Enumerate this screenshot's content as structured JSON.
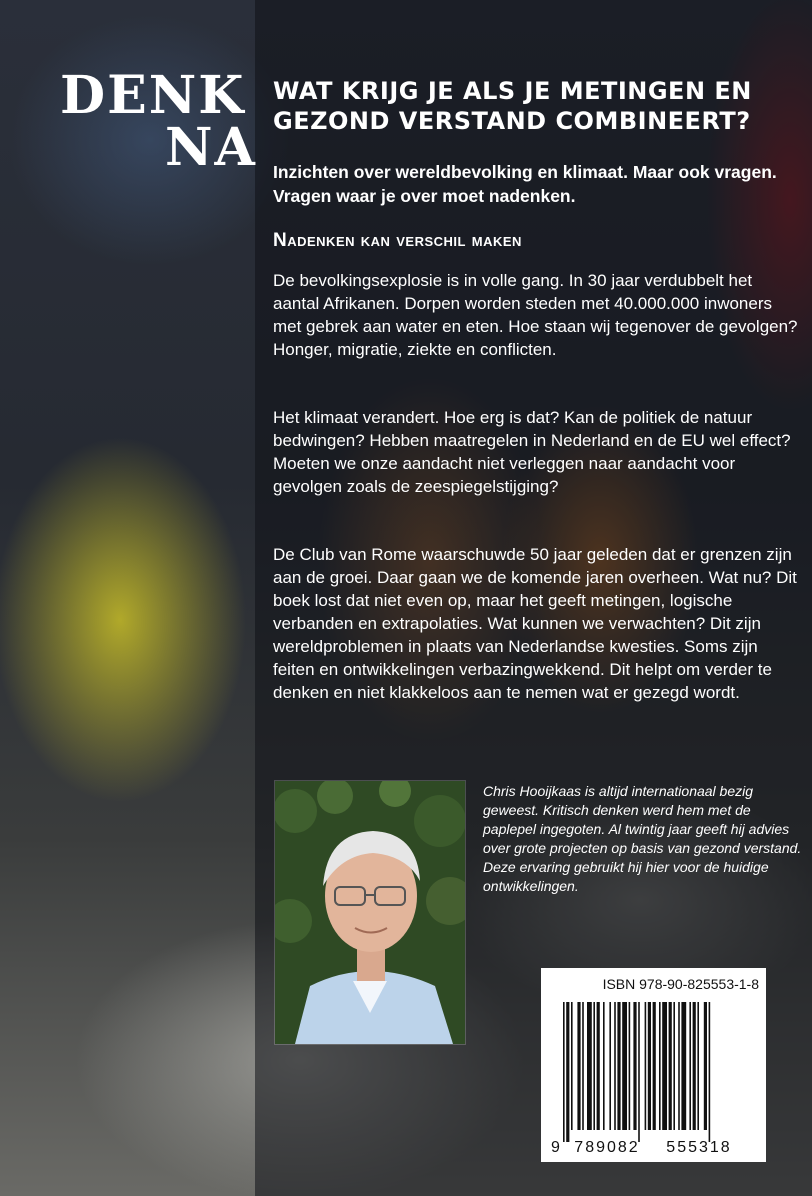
{
  "logo": {
    "line1": "DENK",
    "line2": "NA"
  },
  "headline": "WAT KRIJG JE ALS JE METINGEN EN GEZOND VERSTAND COMBINEERT?",
  "subtitle": "Inzichten over wereldbevolking en klimaat. Maar ook vragen. Vragen waar je over moet nadenken.",
  "section_title": "Nadenken kan verschil maken",
  "paragraphs": [
    "De bevolkingsexplosie is in volle gang. In 30 jaar verdubbelt het aantal Afrikanen. Dorpen worden steden met 40.000.000 inwoners met gebrek aan water en eten. Hoe staan wij tegenover de gevolgen? Honger, migratie, ziekte en conflicten.",
    "Het klimaat verandert. Hoe erg is dat? Kan de politiek de natuur bedwingen? Hebben maatregelen in Nederland en de EU wel effect? Moeten we onze aandacht niet verleggen naar aandacht voor gevolgen zoals de zeespiegelstijging?",
    "De Club van Rome waarschuwde 50 jaar geleden dat er grenzen zijn aan de groei. Daar gaan we de komende jaren overheen. Wat nu? Dit boek lost dat niet even op, maar het geeft metingen, logische verbanden en extrapolaties. Wat kunnen we verwachten? Dit zijn wereldproblemen in plaats van Nederlandse kwesties. Soms zijn feiten en ontwikkelingen verbazingwekkend. Dit helpt om verder te denken en niet klakkeloos aan te nemen wat er gezegd wordt."
  ],
  "author_bio": "Chris Hooijkaas is altijd internationaal bezig geweest. Kritisch denken werd hem met de paplepel ingegoten. Al twintig jaar geeft hij advies over grote projecten op basis van gezond verstand. Deze ervaring gebruikt hij hier voor de huidige ontwikkelingen.",
  "isbn_label": "ISBN 978-90-825553-1-8",
  "barcode_digits": {
    "first": "9",
    "left": "789082",
    "right": "555318"
  },
  "colors": {
    "text": "#ffffff",
    "shirt": "#bcd3ea",
    "hedge": "#2f4a24"
  }
}
